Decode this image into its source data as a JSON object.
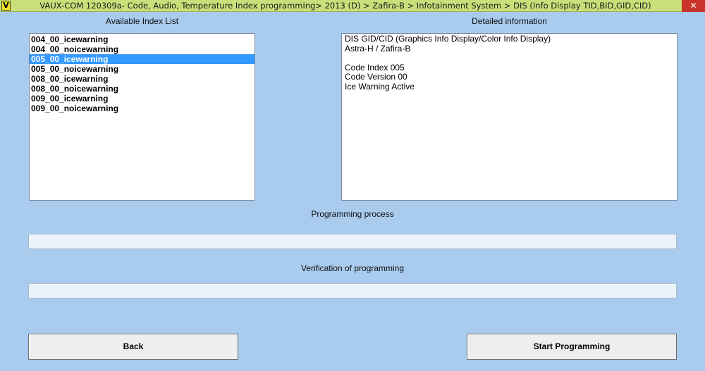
{
  "titlebar": {
    "app_icon": "V",
    "title": "VAUX-COM 120309a- Code, Audio, Temperature Index programming> 2013 (D) > Zafira-B > Infotainment System > DIS (Info Display TID,BID,GID,CID)",
    "close_symbol": "✕"
  },
  "index_list": {
    "label": "Available Index List",
    "items": [
      "004_00_icewarning",
      "004_00_noicewarning",
      "005_00_icewarning",
      "005_00_noicewarning",
      "008_00_icewarning",
      "008_00_noicewarning",
      "009_00_icewarning",
      "009_00_noicewarning"
    ],
    "selected_index": 2
  },
  "details": {
    "label": "Detailed information",
    "lines": [
      "DIS GID/CID (Graphics Info Display/Color Info Display)",
      "Astra-H / Zafira-B",
      "",
      "Code Index 005",
      "Code Version 00",
      "Ice Warning Active"
    ]
  },
  "programming": {
    "label": "Programming process",
    "progress": 0
  },
  "verification": {
    "label": "Verification of programming",
    "progress": 0
  },
  "buttons": {
    "back": "Back",
    "start": "Start Programming"
  },
  "colors": {
    "background": "#a9cbee",
    "titlebar": "#c9e07a",
    "selection": "#3399ff",
    "close": "#c9352a"
  }
}
